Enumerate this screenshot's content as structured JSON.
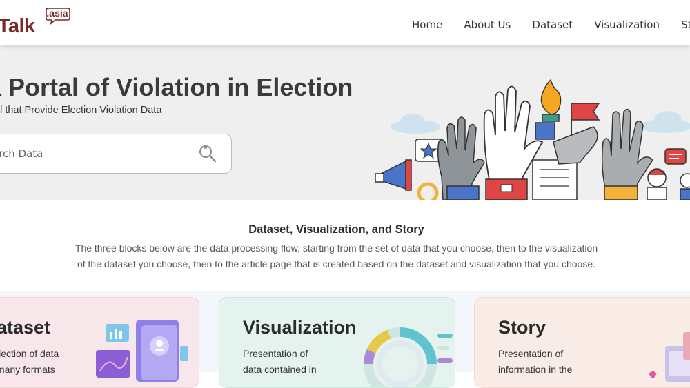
{
  "header": {
    "logo_text": "taTalk",
    "logo_badge": ".asia",
    "nav": [
      "Home",
      "About Us",
      "Dataset",
      "Visualization",
      "Story"
    ]
  },
  "hero": {
    "title": "ta Portal of Violation in Election",
    "subtitle": "tal that Provide Election Violation Data",
    "search_placeholder": "arch Data"
  },
  "section": {
    "title": "Dataset, Visualization, and Story",
    "desc_line1": "The three blocks below are the data processing flow, starting from the set of data that you choose, then to the visualization",
    "desc_line2": "of the dataset you choose, then to the article page that is created based on the dataset and visualization that you choose."
  },
  "cards": [
    {
      "title": "ataset",
      "line1": "llection of data",
      "line2": "many formats"
    },
    {
      "title": "Visualization",
      "line1": "Presentation of",
      "line2": "data contained in"
    },
    {
      "title": "Story",
      "line1": "Presentation of",
      "line2": "information in the"
    }
  ],
  "colors": {
    "brand": "#7a2a28",
    "accent_red": "#e04545",
    "accent_blue": "#4a74c9"
  }
}
